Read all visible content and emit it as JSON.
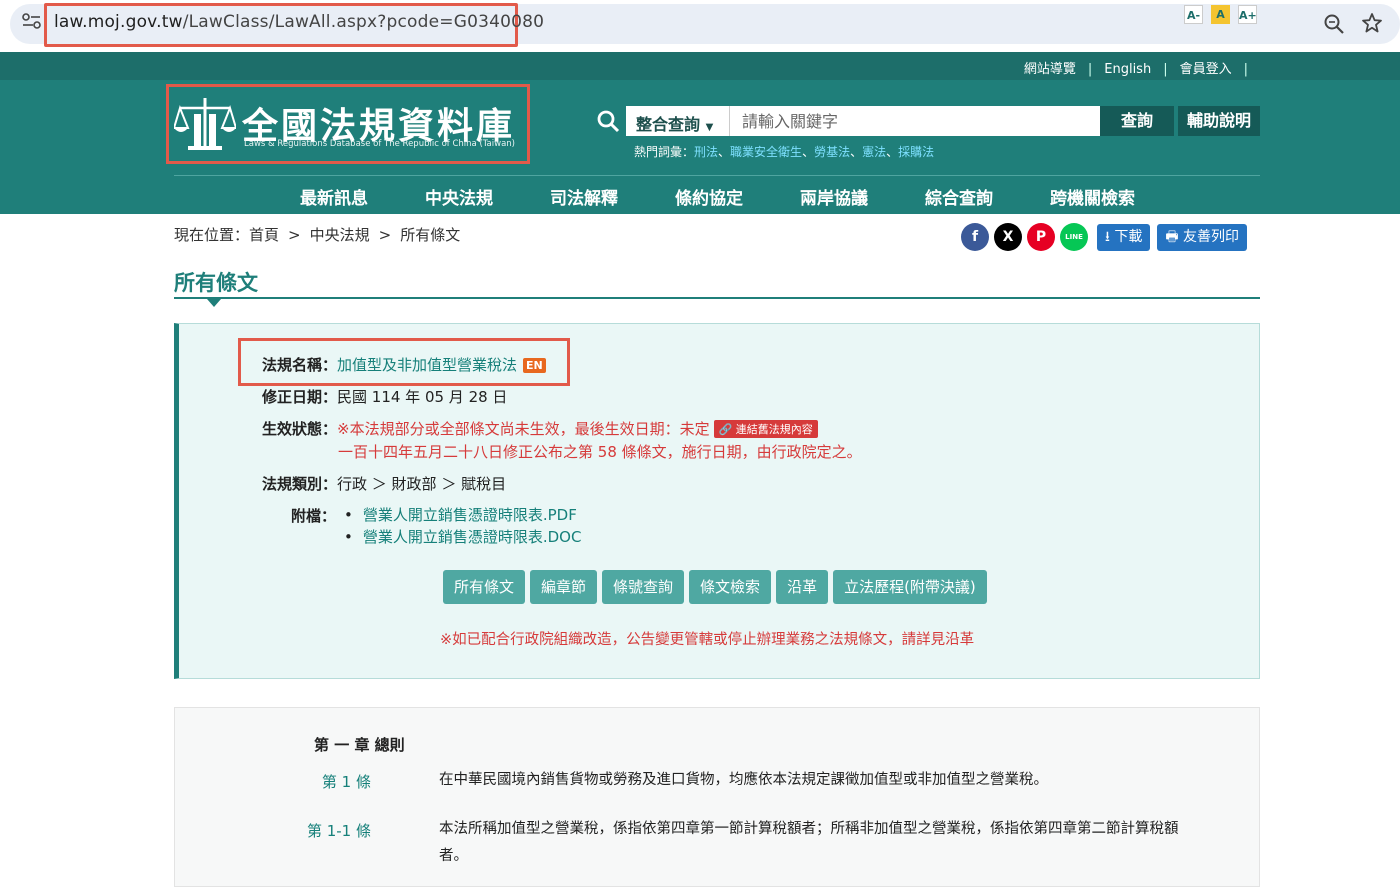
{
  "browser": {
    "url_host": "law.moj.gov.tw",
    "url_path": "/LawClass/LawAll.aspx?pcode=G0340080"
  },
  "util_bar": {
    "links": [
      "網站導覽",
      "English",
      "會員登入"
    ],
    "font_sizes": [
      "A-",
      "A",
      "A+"
    ]
  },
  "header": {
    "logo_title": "全國法規資料庫",
    "logo_subtitle": "Laws & Regulations Database of The Republic of China (Taiwan)",
    "search_scope": "整合查詢",
    "search_placeholder": "請輸入關鍵字",
    "search_button": "查詢",
    "help_button": "輔助說明",
    "hot_words_label": "熱門詞彙：",
    "hot_words": [
      "刑法",
      "職業安全衛生",
      "勞基法",
      "憲法",
      "採購法"
    ],
    "nav": [
      "最新訊息",
      "中央法規",
      "司法解釋",
      "條約協定",
      "兩岸協議",
      "綜合查詢",
      "跨機關檢索"
    ]
  },
  "breadcrumb": {
    "prefix": "現在位置：",
    "items": [
      "首頁",
      "中央法規",
      "所有條文"
    ],
    "separator": ">"
  },
  "share": {
    "facebook": "f",
    "x": "X",
    "plurk": "P",
    "line": "LINE",
    "download": "下載",
    "print": "友善列印"
  },
  "page_title": "所有條文",
  "law": {
    "name_label": "法規名稱：",
    "name": "加值型及非加值型營業稅法",
    "en_badge": "EN",
    "amend_label": "修正日期：",
    "amend_date": "民國 114 年 05 月 28 日",
    "status_label": "生效狀態：",
    "status_line1": "※本法規部分或全部條文尚未生效，最後生效日期：未定",
    "old_link_badge": "連結舊法規內容",
    "status_line2": "一百十四年五月二十八日修正公布之第 58 條條文，施行日期，由行政院定之。",
    "category_label": "法規類別：",
    "category": "行政 ＞ 財政部 ＞ 賦稅目",
    "attach_label": "附檔：",
    "attachments": [
      "營業人開立銷售憑證時限表.PDF",
      "營業人開立銷售憑證時限表.DOC"
    ]
  },
  "tabs": [
    "所有條文",
    "編章節",
    "條號查詢",
    "條文檢索",
    "沿革",
    "立法歷程(附帶決議)"
  ],
  "notice": "※如已配合行政院組織改造，公告變更管轄或停止辦理業務之法規條文，請詳見沿革",
  "articles": {
    "chapter": "第 一 章 總則",
    "items": [
      {
        "no": "第 1 條",
        "text": "在中華民國境內銷售貨物或勞務及進口貨物，均應依本法規定課徵加值型或非加值型之營業稅。"
      },
      {
        "no": "第 1-1 條",
        "text": "本法所稱加值型之營業稅，係指依第四章第一節計算稅額者；所稱非加值型之營業稅，係指依第四章第二節計算稅額者。"
      }
    ]
  },
  "colors": {
    "teal": "#1f7f7a",
    "highlight": "#e25a4a",
    "red_text": "#d63a3a",
    "link": "#16807a"
  }
}
